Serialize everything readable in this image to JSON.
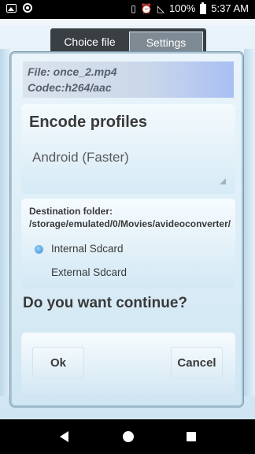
{
  "status_bar": {
    "battery_text": "100%",
    "time": "5:37 AM",
    "icons": [
      "image-icon",
      "record-icon",
      "vibrate-icon",
      "alarm-icon",
      "no-signal-icon",
      "battery-charging-icon"
    ]
  },
  "tabs": [
    {
      "label": "Choice file"
    },
    {
      "label": "Settings"
    }
  ],
  "dialog": {
    "file_line": "File: once_2.mp4",
    "codec_line": "Codec:h264/aac",
    "encode_profiles_title": "Encode profiles",
    "encode_profile_value": "Android (Faster)",
    "destination_text": "Destination folder: /storage/emulated/0/Movies/avideoconverter/",
    "radio_options": [
      "Internal Sdcard",
      "External Sdcard"
    ],
    "selected_option": "Internal Sdcard",
    "question": "Do you want continue?",
    "ok_label": "Ok",
    "cancel_label": "Cancel"
  },
  "nav_bar": {
    "icons": [
      "back-icon",
      "home-icon",
      "recents-icon"
    ]
  }
}
